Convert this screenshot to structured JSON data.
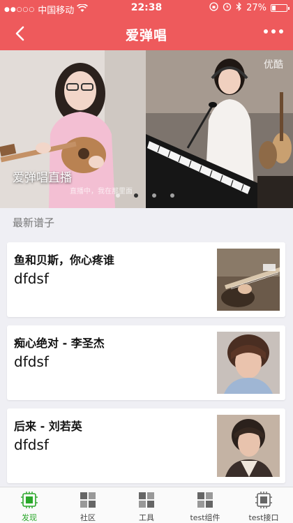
{
  "status_bar": {
    "carrier": "中国移动",
    "time": "22:38",
    "battery": "27%",
    "battery_level": 0.27
  },
  "navbar": {
    "title": "爱弹唱"
  },
  "banner": {
    "caption": "爱弹唱直播",
    "subcaption": "直播中，我在那里面",
    "watermark": "优酷",
    "page_count": 4,
    "active_page": 2
  },
  "section": {
    "title": "最新谱子"
  },
  "songs": [
    {
      "title": "鱼和贝斯，你心疼谁",
      "subtitle": "dfdsf",
      "thumb": "guitar-photo"
    },
    {
      "title": "痴心绝对 - 李圣杰",
      "subtitle": "dfdsf",
      "thumb": "singer-photo"
    },
    {
      "title": "后来 - 刘若英",
      "subtitle": "dfdsf",
      "thumb": "singer-photo"
    }
  ],
  "tabs": [
    {
      "label": "发现",
      "icon": "chip-icon",
      "active": true
    },
    {
      "label": "社区",
      "icon": "grid-icon",
      "active": false
    },
    {
      "label": "工具",
      "icon": "grid-icon",
      "active": false
    },
    {
      "label": "test组件",
      "icon": "grid-icon",
      "active": false
    },
    {
      "label": "test接口",
      "icon": "chip-icon",
      "active": false
    }
  ],
  "colors": {
    "brand": "#ee5a5c",
    "tab_active": "#2aa72a"
  }
}
